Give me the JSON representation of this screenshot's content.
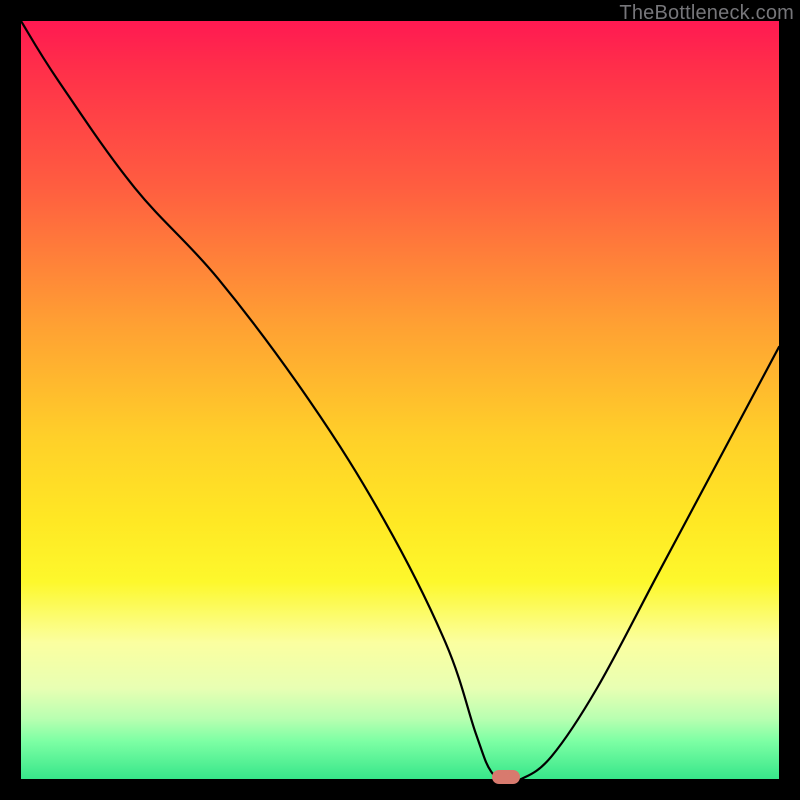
{
  "watermark": "TheBottleneck.com",
  "chart_data": {
    "type": "line",
    "title": "",
    "xlabel": "",
    "ylabel": "",
    "xlim": [
      0,
      100
    ],
    "ylim": [
      0,
      100
    ],
    "grid": false,
    "legend": false,
    "series": [
      {
        "name": "bottleneck-curve",
        "x": [
          0,
          5,
          15,
          26,
          38,
          48,
          56,
          60,
          62,
          64,
          66,
          70,
          76,
          84,
          92,
          100
        ],
        "y": [
          100,
          92,
          78,
          66,
          50,
          34,
          18,
          6,
          1,
          0,
          0,
          3,
          12,
          27,
          42,
          57
        ]
      }
    ],
    "marker": {
      "x": 64,
      "y": 0
    },
    "gradient_stops": [
      {
        "pos": 0,
        "color": "#ff1952"
      },
      {
        "pos": 6,
        "color": "#ff2e4a"
      },
      {
        "pos": 22,
        "color": "#ff5e40"
      },
      {
        "pos": 40,
        "color": "#ffa033"
      },
      {
        "pos": 55,
        "color": "#ffd029"
      },
      {
        "pos": 66,
        "color": "#ffe824"
      },
      {
        "pos": 74,
        "color": "#fdf82c"
      },
      {
        "pos": 82,
        "color": "#fbffa0"
      },
      {
        "pos": 88,
        "color": "#e8ffb3"
      },
      {
        "pos": 92,
        "color": "#b9ffb1"
      },
      {
        "pos": 95,
        "color": "#7dffa4"
      },
      {
        "pos": 100,
        "color": "#37e68a"
      }
    ]
  }
}
